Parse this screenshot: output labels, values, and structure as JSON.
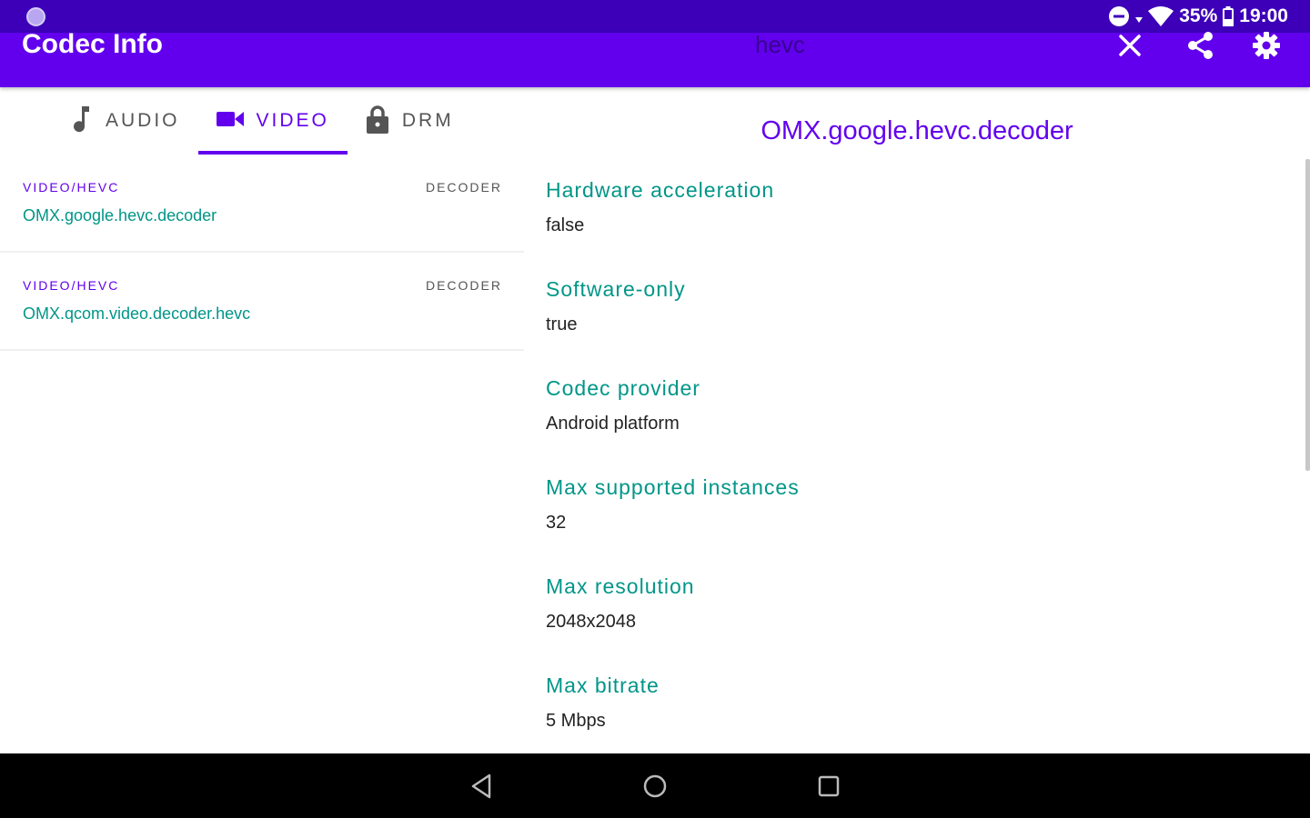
{
  "status_bar": {
    "battery_percent": "35%",
    "time": "19:00"
  },
  "app_bar": {
    "title": "Codec Info",
    "search_query": "hevc",
    "icons": [
      "close-icon",
      "share-icon",
      "settings-icon"
    ]
  },
  "tabs": [
    {
      "label": "AUDIO",
      "icon": "music-note-icon",
      "active": false
    },
    {
      "label": "VIDEO",
      "icon": "videocam-icon",
      "active": true
    },
    {
      "label": "DRM",
      "icon": "lock-icon",
      "active": false
    }
  ],
  "codec_list": [
    {
      "mime": "VIDEO/HEVC",
      "type": "DECODER",
      "name": "OMX.google.hevc.decoder"
    },
    {
      "mime": "VIDEO/HEVC",
      "type": "DECODER",
      "name": "OMX.qcom.video.decoder.hevc"
    }
  ],
  "detail": {
    "title": "OMX.google.hevc.decoder",
    "properties": [
      {
        "label": "Hardware acceleration",
        "value": "false"
      },
      {
        "label": "Software-only",
        "value": "true"
      },
      {
        "label": "Codec provider",
        "value": "Android platform"
      },
      {
        "label": "Max supported instances",
        "value": "32"
      },
      {
        "label": "Max resolution",
        "value": "2048x2048"
      },
      {
        "label": "Max bitrate",
        "value": "5 Mbps"
      }
    ]
  },
  "nav_bar": {
    "icons": [
      "back-icon",
      "home-icon",
      "recents-icon"
    ]
  },
  "colors": {
    "primary": "#6200ee",
    "primary_dark": "#3d00b8",
    "accent_teal": "#009688"
  }
}
